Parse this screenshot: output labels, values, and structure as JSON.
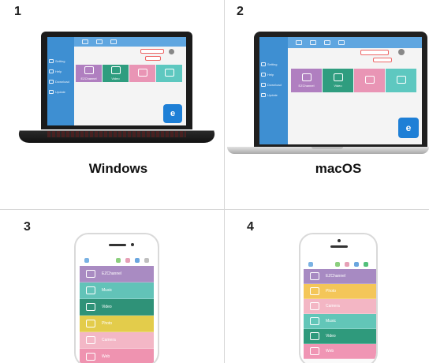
{
  "panels": [
    {
      "number": "1",
      "label": "Windows"
    },
    {
      "number": "2",
      "label": "macOS"
    },
    {
      "number": "3",
      "label": ""
    },
    {
      "number": "4",
      "label": ""
    }
  ],
  "desktop_app": {
    "sidebar_items": [
      "Setting",
      "Help",
      "Download",
      "Update"
    ],
    "tiles": [
      {
        "label": "EZChannel",
        "color": "#b07fc0"
      },
      {
        "label": "Video",
        "color": "#2f9d7f"
      },
      {
        "label": "",
        "color": "#e995b5"
      },
      {
        "label": "",
        "color": "#5ec8c0"
      }
    ]
  },
  "phone3_rows": [
    {
      "label": "EZChannel",
      "color": "#a98bc2"
    },
    {
      "label": "Music",
      "color": "#62c3b8"
    },
    {
      "label": "Video",
      "color": "#2f9278"
    },
    {
      "label": "Photo",
      "color": "#e3cc4b"
    },
    {
      "label": "Camera",
      "color": "#f3b7c6"
    },
    {
      "label": "Web",
      "color": "#ef93b0"
    }
  ],
  "phone4_rows": [
    {
      "label": "EZChannel",
      "color": "#a78ac2"
    },
    {
      "label": "Photo",
      "color": "#f4c659"
    },
    {
      "label": "Camera",
      "color": "#f3b6c4"
    },
    {
      "label": "Music",
      "color": "#62c6b8"
    },
    {
      "label": "Video",
      "color": "#2f9a7c"
    },
    {
      "label": "Web",
      "color": "#f095b4"
    }
  ],
  "colors": {
    "sidebar_blue": "#3e8fd2",
    "brand_blue": "#1e7fd6"
  }
}
